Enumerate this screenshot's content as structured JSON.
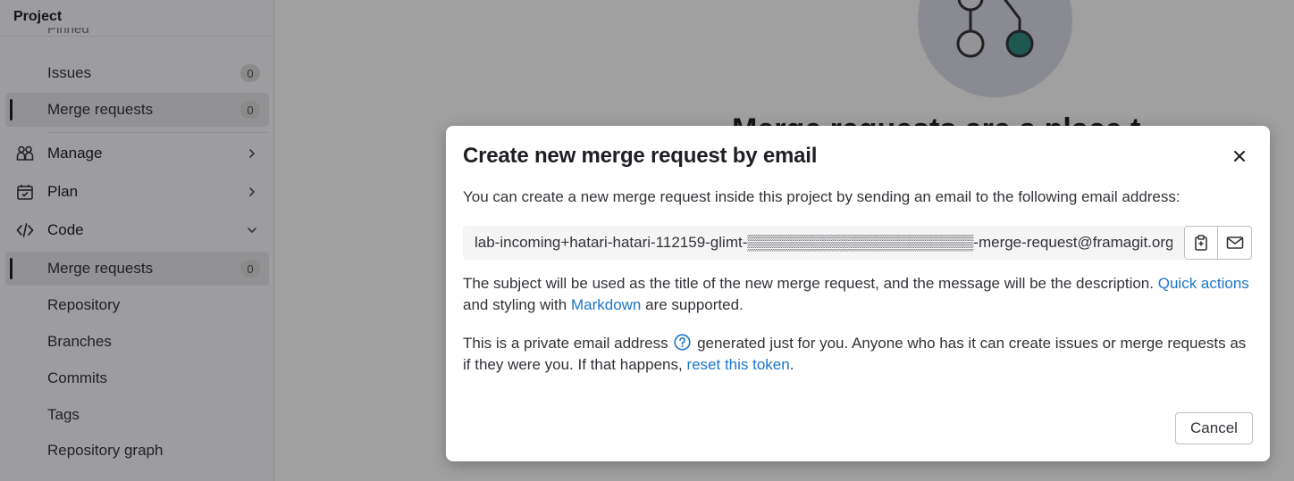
{
  "sidebar": {
    "header": "Project",
    "cutoff_label": "Pinned",
    "items": [
      {
        "label": "Issues",
        "count": "0"
      },
      {
        "label": "Merge requests",
        "count": "0"
      }
    ],
    "sections": [
      {
        "label": "Manage",
        "icon": "users-icon"
      },
      {
        "label": "Plan",
        "icon": "calendar-icon"
      },
      {
        "label": "Code",
        "icon": "code-icon"
      }
    ],
    "code_items": [
      {
        "label": "Merge requests",
        "count": "0"
      },
      {
        "label": "Repository"
      },
      {
        "label": "Branches"
      },
      {
        "label": "Commits"
      },
      {
        "label": "Tags"
      },
      {
        "label": "Repository graph"
      }
    ]
  },
  "main": {
    "bg_heading": "Merge requests are a place t"
  },
  "modal": {
    "title": "Create new merge request by email",
    "description": "You can create a new merge request inside this project by sending an email to the following email address:",
    "email": "lab-incoming+hatari-hatari-112159-glimt-▒▒▒▒▒▒▒▒▒▒▒▒▒▒▒▒▒▒▒▒▒-merge-request@framagit.org",
    "subject_text_before": "The subject will be used as the title of the new merge request, and the message will be the description.",
    "quick_actions_link": "Quick actions",
    "subject_text_middle": "and styling with",
    "markdown_link": "Markdown",
    "subject_text_after": "are supported.",
    "private_text_before": "This is a private email address",
    "private_text_after": "generated just for you. Anyone who has it can create issues or merge requests as if they were you. If that happens,",
    "reset_link": "reset this token",
    "cancel_label": "Cancel"
  },
  "colors": {
    "link": "#1f75cb",
    "illustration_teal": "#2e8b7f",
    "overlay": "rgba(5,5,6,0.38)"
  }
}
